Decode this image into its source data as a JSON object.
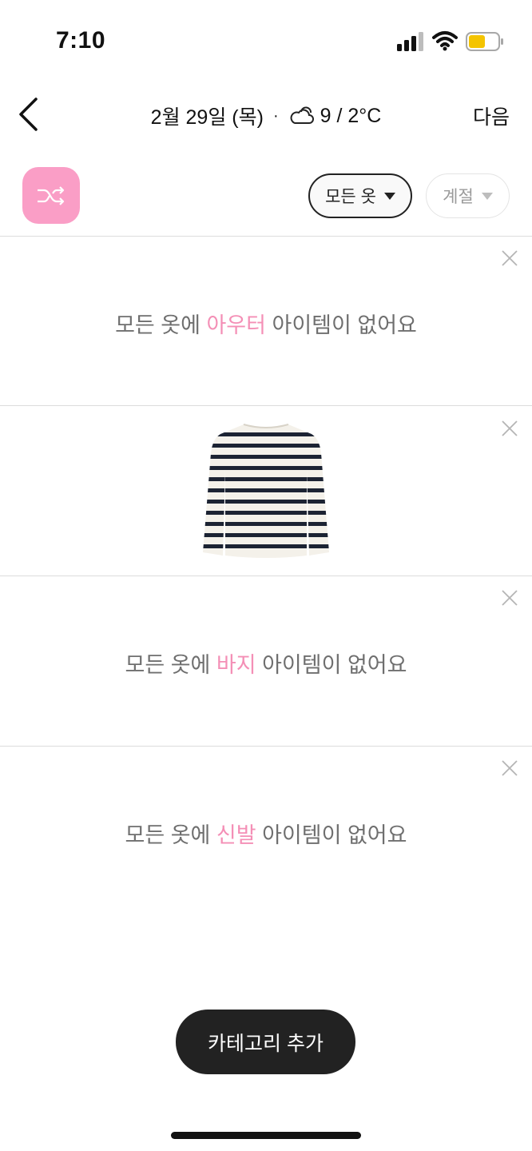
{
  "status_bar": {
    "time": "7:10"
  },
  "nav": {
    "date": "2월 29일 (목)",
    "separator": "·",
    "temperature": "9 / 2°C",
    "next_label": "다음",
    "weather_icon": "cloud-icon"
  },
  "toolbar": {
    "shuffle_icon": "shuffle-icon",
    "filter_label": "모든 옷",
    "season_label": "계절"
  },
  "categories": [
    {
      "prefix": "모든 옷",
      "particle": "에 ",
      "name": "아우터",
      "suffix": " 아이템이 없어요"
    },
    {
      "item_icon": "striped-shirt-icon"
    },
    {
      "prefix": "모든 옷",
      "particle": "에 ",
      "name": "바지",
      "suffix": " 아이템이 없어요"
    },
    {
      "prefix": "모든 옷",
      "particle": "에 ",
      "name": "신발",
      "suffix": " 아이템이 없어요"
    }
  ],
  "add_category_label": "카테고리 추가",
  "colors": {
    "accent": "#fa9ec6",
    "accent_text": "#f48fb6",
    "dark": "#222222"
  }
}
